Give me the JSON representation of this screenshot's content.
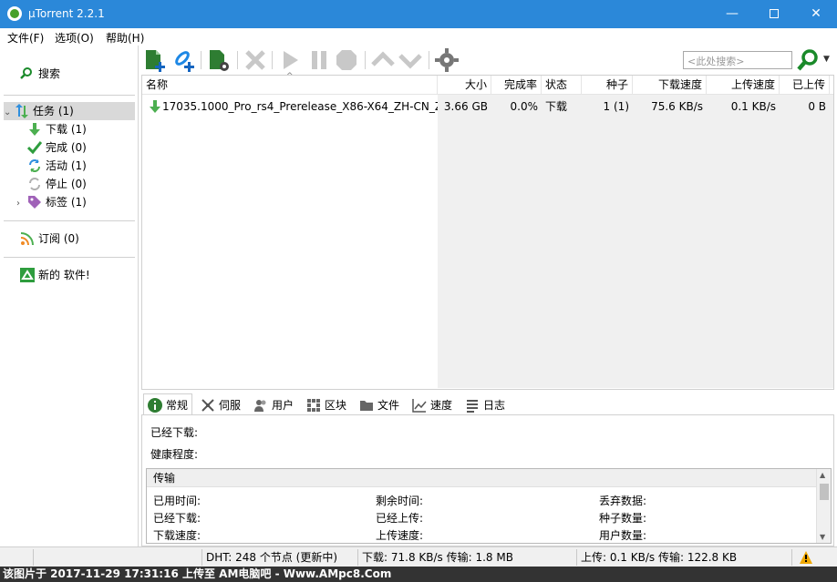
{
  "window": {
    "title": "µTorrent 2.2.1",
    "minimize": "—",
    "close": "✕"
  },
  "menu": [
    "文件(F)",
    "选项(O)",
    "帮助(H)"
  ],
  "sidebar": {
    "search_label": "搜索",
    "tasks": {
      "label": "任务 (1)"
    },
    "items": [
      {
        "label": "下载 (1)",
        "icon": "download-arrow-icon",
        "color": "#4caf50"
      },
      {
        "label": "完成 (0)",
        "icon": "checkmark-icon",
        "color": "#2e9d3e"
      },
      {
        "label": "活动 (1)",
        "icon": "refresh-arrows-icon",
        "color": "#2f8fde"
      },
      {
        "label": "停止 (0)",
        "icon": "stop-arrows-icon",
        "color": "#b0b0b0"
      },
      {
        "label": "标签 (1)",
        "icon": "tag-icon",
        "color": "#a062b8"
      }
    ],
    "feeds": {
      "label": "订阅 (0)"
    },
    "apps": {
      "label": "新的 软件!"
    }
  },
  "toolbar": {
    "search_placeholder": "<此处搜索>",
    "buttons": [
      "add-torrent",
      "add-url",
      "create-torrent",
      "remove",
      "start",
      "pause",
      "stop",
      "move-up",
      "move-down",
      "preferences"
    ]
  },
  "columns": [
    "名称",
    "大小",
    "完成率",
    "状态",
    "种子",
    "下载速度",
    "上传速度",
    "已上传"
  ],
  "torrents": [
    {
      "name": "17035.1000_Pro_rs4_Prerelease_X86-X64_ZH-CN_Z...",
      "size": "3.66 GB",
      "done": "0.0%",
      "status": "下载",
      "seeds": "1 (1)",
      "down_speed": "75.6 KB/s",
      "up_speed": "0.1 KB/s",
      "uploaded": "0 B"
    }
  ],
  "tabs": [
    "常规",
    "伺服",
    "用户",
    "区块",
    "文件",
    "速度",
    "日志"
  ],
  "general": {
    "downloaded_label": "已经下载:",
    "health_label": "健康程度:",
    "transfer_header": "传输",
    "fields": [
      "已用时间:",
      "剩余时间:",
      "丢弃数据:",
      "已经下载:",
      "已经上传:",
      "种子数量:",
      "下载速度:",
      "上传速度:",
      "用户数量:"
    ]
  },
  "status": {
    "dht": "DHT: 248 个节点 (更新中)",
    "download": "下载: 71.8 KB/s 传输: 1.8 MB",
    "upload": "上传: 0.1 KB/s 传输: 122.8 KB"
  },
  "watermark": "该图片于 2017-11-29 17:31:16 上传至 AM电脑吧 - Www.AMpc8.Com"
}
